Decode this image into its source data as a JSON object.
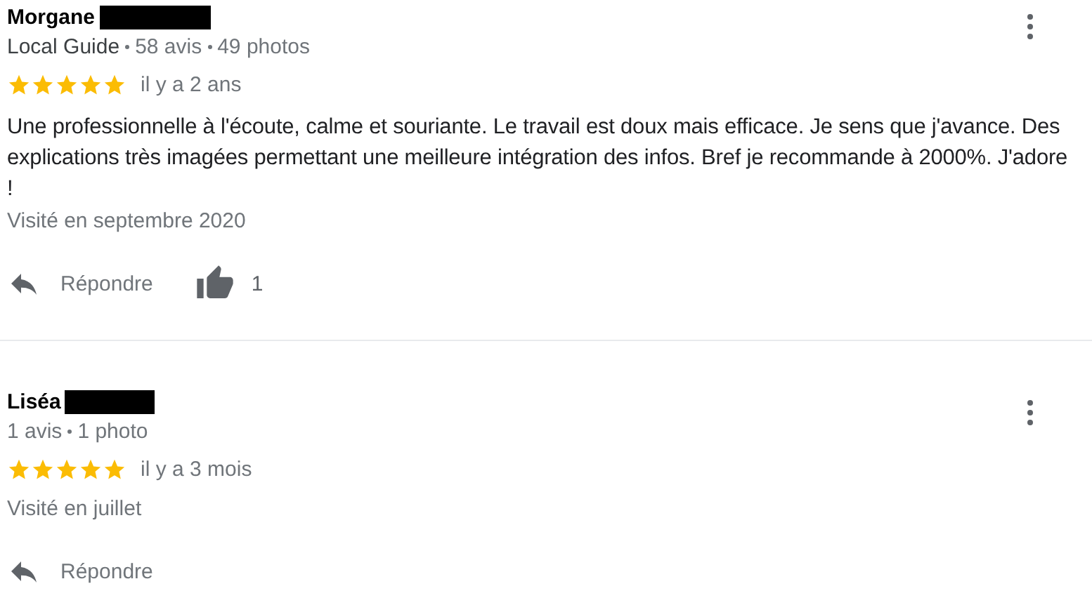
{
  "reviews": [
    {
      "name": "Morgane",
      "badge": "Local Guide",
      "stats": [
        "58 avis",
        "49 photos"
      ],
      "stars": 5,
      "time": "il y a 2 ans",
      "text": "Une professionnelle à l'écoute, calme et souriante. Le travail est doux mais efficace. Je sens que j'avance. Des explications très imagées permettant une meilleure intégration des infos. Bref je recommande à 2000%. J'adore !",
      "visited": "Visité en septembre 2020",
      "reply": "Répondre",
      "likes": "1"
    },
    {
      "name": "Liséa",
      "stats": [
        "1 avis",
        "1 photo"
      ],
      "stars": 5,
      "time": "il y a 3 mois",
      "visited": "Visité en juillet",
      "reply": "Répondre"
    }
  ]
}
